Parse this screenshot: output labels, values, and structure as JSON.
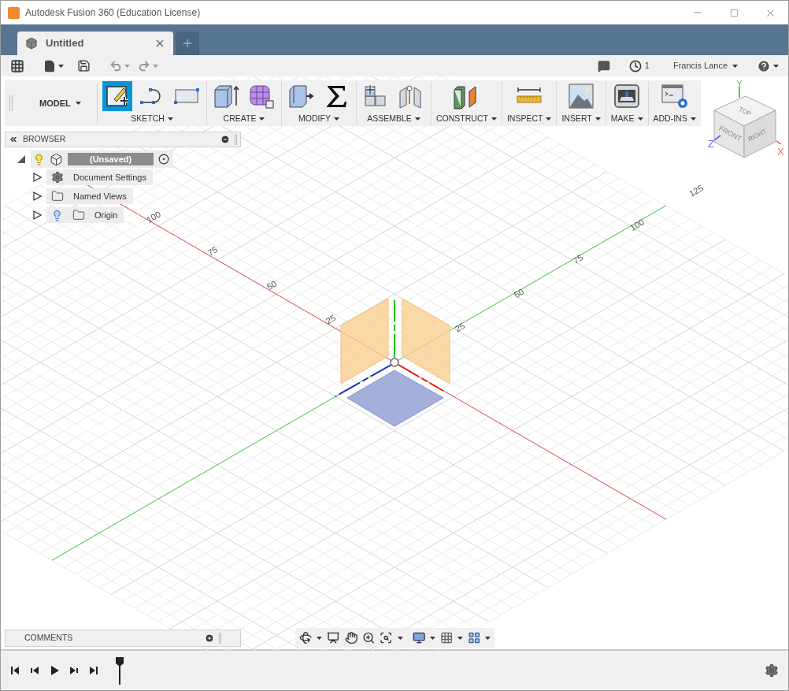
{
  "window": {
    "title": "Autodesk Fusion 360 (Education License)"
  },
  "tabs": [
    {
      "label": "Untitled",
      "selected": true
    }
  ],
  "quick_access": {
    "jobs_count": "1",
    "user": "Francis Lance"
  },
  "toolbar": {
    "workspace": "MODEL",
    "groups": [
      {
        "label": "SKETCH",
        "tools": [
          {
            "kind": "sketch",
            "selected": true
          },
          {
            "kind": "arc",
            "selected": false
          },
          {
            "kind": "rectangle",
            "selected": false
          }
        ]
      },
      {
        "label": "CREATE",
        "tools": [
          {
            "kind": "extrude",
            "selected": false
          },
          {
            "kind": "form",
            "selected": false
          }
        ]
      },
      {
        "label": "MODIFY",
        "tools": [
          {
            "kind": "press-pull",
            "selected": false
          },
          {
            "kind": "formula",
            "selected": false
          }
        ]
      },
      {
        "label": "ASSEMBLE",
        "tools": [
          {
            "kind": "new-component",
            "selected": false
          },
          {
            "kind": "joint",
            "selected": false
          }
        ]
      },
      {
        "label": "CONSTRUCT",
        "tools": [
          {
            "kind": "plane",
            "selected": false
          }
        ]
      },
      {
        "label": "INSPECT",
        "tools": [
          {
            "kind": "measure",
            "selected": false
          }
        ]
      },
      {
        "label": "INSERT",
        "tools": [
          {
            "kind": "image",
            "selected": false
          }
        ]
      },
      {
        "label": "MAKE",
        "tools": [
          {
            "kind": "print3d",
            "selected": false
          }
        ]
      },
      {
        "label": "ADD-INS",
        "tools": [
          {
            "kind": "scripts",
            "selected": false
          }
        ]
      }
    ]
  },
  "browser": {
    "title": "BROWSER",
    "root": {
      "label": "(Unsaved)",
      "expanded": true,
      "children": [
        {
          "label": "Document Settings",
          "kind": "settings",
          "expanded": false
        },
        {
          "label": "Named Views",
          "kind": "folder",
          "expanded": false
        },
        {
          "label": "Origin",
          "kind": "folder-light",
          "expanded": false
        }
      ]
    }
  },
  "viewcube": {
    "top": "TOP",
    "front": "FRONT",
    "right": "RIGHT",
    "x": "X",
    "y": "Y",
    "z": "Z"
  },
  "grid_labels": {
    "red_axis": [
      "25",
      "50",
      "75",
      "100"
    ],
    "green_axis": [
      "25",
      "50",
      "75",
      "100",
      "125"
    ]
  },
  "comments": {
    "title": "COMMENTS"
  }
}
